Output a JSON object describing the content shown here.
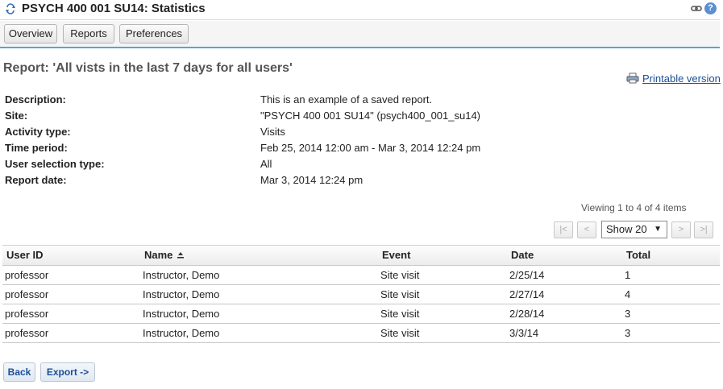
{
  "header": {
    "tool_title": "PSYCH 400 001 SU14: Statistics",
    "reset_icon": "reset-arrows-icon",
    "link_icon": "link-icon",
    "help_icon": "help-icon",
    "help_glyph": "?"
  },
  "nav": {
    "tabs": [
      {
        "label": "Overview"
      },
      {
        "label": "Reports"
      },
      {
        "label": "Preferences"
      }
    ]
  },
  "report": {
    "title": "Report: 'All vists in the last 7 days for all users'",
    "printable_label": "Printable version",
    "info": [
      {
        "label": "Description:",
        "value": "This is an example of a saved report."
      },
      {
        "label": "Site:",
        "value": "\"PSYCH 400 001 SU14\" (psych400_001_su14)"
      },
      {
        "label": "Activity type:",
        "value": "Visits"
      },
      {
        "label": "Time period:",
        "value": "Feb 25, 2014 12:00 am - Mar 3, 2014 12:24 pm"
      },
      {
        "label": "User selection type:",
        "value": "All"
      },
      {
        "label": "Report date:",
        "value": "Mar 3, 2014 12:24 pm"
      }
    ]
  },
  "pager": {
    "viewing_text": "Viewing 1 to 4 of 4 items",
    "first": "|<",
    "prev": "<",
    "next": ">",
    "last": ">|",
    "page_size": "Show 20",
    "arrow": "▼"
  },
  "table": {
    "columns": [
      "User ID",
      "Name",
      "Event",
      "Date",
      "Total"
    ],
    "sorted_column": "Name",
    "rows": [
      [
        "professor",
        "Instructor, Demo",
        "Site visit",
        "2/25/14",
        "1"
      ],
      [
        "professor",
        "Instructor, Demo",
        "Site visit",
        "2/27/14",
        "4"
      ],
      [
        "professor",
        "Instructor, Demo",
        "Site visit",
        "2/28/14",
        "3"
      ],
      [
        "professor",
        "Instructor, Demo",
        "Site visit",
        "3/3/14",
        "3"
      ]
    ]
  },
  "actions": {
    "back": "Back",
    "export": "Export ->"
  },
  "colors": {
    "accent_blue": "#5ba3d6",
    "link_blue": "#1a4e95"
  }
}
